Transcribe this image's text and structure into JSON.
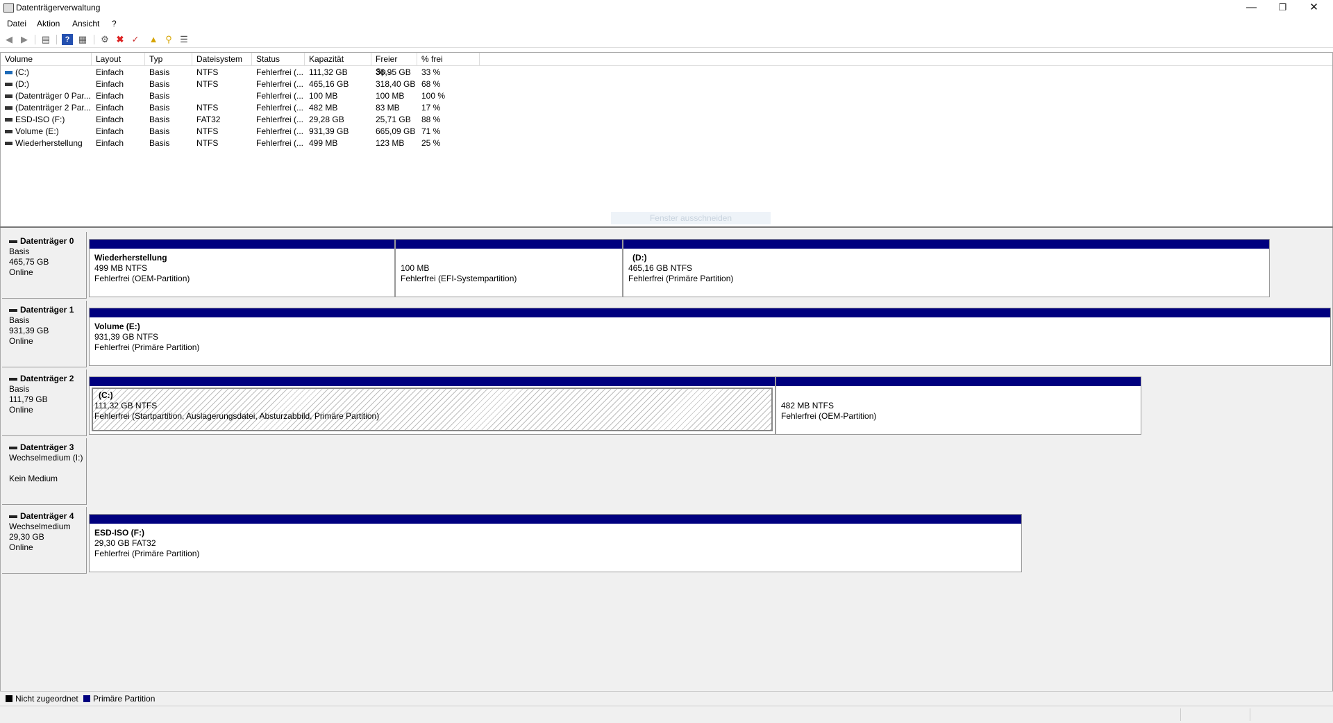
{
  "window": {
    "title": "Datenträgerverwaltung"
  },
  "menu": {
    "datei": "Datei",
    "aktion": "Aktion",
    "ansicht": "Ansicht",
    "help": "?"
  },
  "toolbar": {
    "icons": [
      "back-icon",
      "forward-icon",
      "console-tree-icon",
      "help-icon",
      "properties-icon",
      "connect-icon",
      "delete-icon",
      "check-icon",
      "folder-up-icon",
      "search-icon",
      "list-view-icon"
    ]
  },
  "columns": [
    "Volume",
    "Layout",
    "Typ",
    "Dateisystem",
    "Status",
    "Kapazität",
    "Freier Sp...",
    "% frei"
  ],
  "volumes": [
    {
      "volume": "(C:)",
      "layout": "Einfach",
      "typ": "Basis",
      "fs": "NTFS",
      "status": "Fehlerfrei (...",
      "kap": "111,32 GB",
      "frei": "36,95 GB",
      "pct": "33 %"
    },
    {
      "volume": "(D:)",
      "layout": "Einfach",
      "typ": "Basis",
      "fs": "NTFS",
      "status": "Fehlerfrei (...",
      "kap": "465,16 GB",
      "frei": "318,40 GB",
      "pct": "68 %"
    },
    {
      "volume": "(Datenträger 0 Par...",
      "layout": "Einfach",
      "typ": "Basis",
      "fs": "",
      "status": "Fehlerfrei (...",
      "kap": "100 MB",
      "frei": "100 MB",
      "pct": "100 %"
    },
    {
      "volume": "(Datenträger 2 Par...",
      "layout": "Einfach",
      "typ": "Basis",
      "fs": "NTFS",
      "status": "Fehlerfrei (...",
      "kap": "482 MB",
      "frei": "83 MB",
      "pct": "17 %"
    },
    {
      "volume": "ESD-ISO (F:)",
      "layout": "Einfach",
      "typ": "Basis",
      "fs": "FAT32",
      "status": "Fehlerfrei (...",
      "kap": "29,28 GB",
      "frei": "25,71 GB",
      "pct": "88 %"
    },
    {
      "volume": "Volume (E:)",
      "layout": "Einfach",
      "typ": "Basis",
      "fs": "NTFS",
      "status": "Fehlerfrei (...",
      "kap": "931,39 GB",
      "frei": "665,09 GB",
      "pct": "71 %"
    },
    {
      "volume": "Wiederherstellung",
      "layout": "Einfach",
      "typ": "Basis",
      "fs": "NTFS",
      "status": "Fehlerfrei (...",
      "kap": "499 MB",
      "frei": "123 MB",
      "pct": "25 %"
    }
  ],
  "ghost_tooltip": "Fenster ausschneiden",
  "disks": [
    {
      "name": "Datenträger 0",
      "type": "Basis",
      "size": "465,75 GB",
      "state": "Online",
      "partitions": [
        {
          "name": "Wiederherstellung",
          "size": "499 MB NTFS",
          "status": "Fehlerfrei (OEM-Partition)"
        },
        {
          "name": "",
          "size": "100 MB",
          "status": "Fehlerfrei (EFI-Systempartition)"
        },
        {
          "name": "(D:)",
          "size": "465,16 GB NTFS",
          "status": "Fehlerfrei (Primäre Partition)"
        }
      ]
    },
    {
      "name": "Datenträger 1",
      "type": "Basis",
      "size": "931,39 GB",
      "state": "Online",
      "partitions": [
        {
          "name": "Volume  (E:)",
          "size": "931,39 GB NTFS",
          "status": "Fehlerfrei (Primäre Partition)"
        }
      ]
    },
    {
      "name": "Datenträger 2",
      "type": "Basis",
      "size": "111,79 GB",
      "state": "Online",
      "partitions": [
        {
          "name": "(C:)",
          "size": "111,32 GB NTFS",
          "status": "Fehlerfrei (Startpartition, Auslagerungsdatei, Absturzabbild, Primäre Partition)"
        },
        {
          "name": "",
          "size": "482 MB NTFS",
          "status": "Fehlerfrei (OEM-Partition)"
        }
      ]
    },
    {
      "name": "Datenträger 3",
      "type": "Wechselmedium (I:)",
      "size": "",
      "state": "Kein Medium",
      "partitions": []
    },
    {
      "name": "Datenträger 4",
      "type": "Wechselmedium",
      "size": "29,30 GB",
      "state": "Online",
      "partitions": [
        {
          "name": "ESD-ISO  (F:)",
          "size": "29,30 GB FAT32",
          "status": "Fehlerfrei (Primäre Partition)"
        }
      ]
    }
  ],
  "legend": {
    "unallocated": "Nicht zugeordnet",
    "primary": "Primäre Partition",
    "colors": {
      "unallocated": "#000000",
      "primary": "#00007f"
    }
  }
}
